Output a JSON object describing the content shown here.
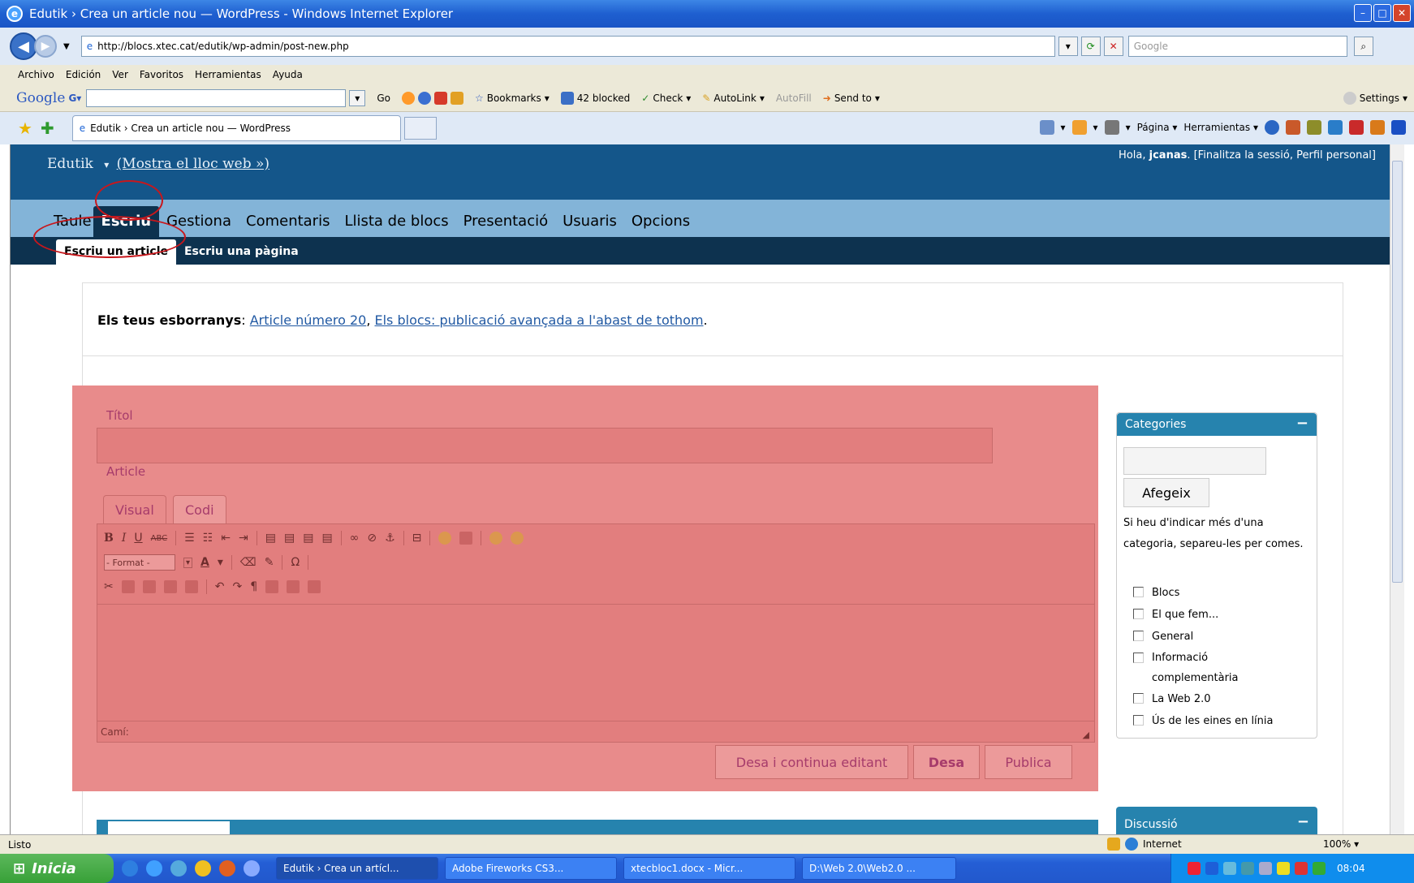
{
  "window": {
    "title": "Edutik › Crea un article nou — WordPress - Windows Internet Explorer",
    "url": "http://blocs.xtec.cat/edutik/wp-admin/post-new.php",
    "search_placeholder": "Google"
  },
  "menu": [
    "Archivo",
    "Edición",
    "Ver",
    "Favoritos",
    "Herramientas",
    "Ayuda"
  ],
  "googlebar": {
    "logo": "Google",
    "go": "Go",
    "bookmarks": "Bookmarks",
    "blocked": "42 blocked",
    "check": "Check",
    "autolink": "AutoLink",
    "autofill": "AutoFill",
    "sendto": "Send to",
    "settings": "Settings"
  },
  "tab": {
    "label": "Edutik › Crea un article nou — WordPress"
  },
  "commandbar": {
    "page": "Página",
    "tools": "Herramientas"
  },
  "wp": {
    "blog_name": "Edutik",
    "visit_site": "(Mostra el lloc web »)",
    "greeting": "Hola,",
    "username": "jcanas",
    "user_links": ". [Finalitza la sessió, Perfil personal]",
    "menu": [
      "Tauler",
      "Escriu",
      "Gestiona",
      "Comentaris",
      "Llista de blocs",
      "Presentació",
      "Usuaris",
      "Opcions"
    ],
    "menu_display": [
      "Taule",
      "Escriu",
      "Gestiona",
      "Comentaris",
      "Llista de blocs",
      "Presentació",
      "Usuaris",
      "Opcions"
    ],
    "submenu": [
      "Escriu un article",
      "Escriu una pàgina"
    ],
    "drafts_label": "Els teus esborranys",
    "drafts": [
      "Article número 20",
      "Els blocs: publicació avançada a l'abast de tothom"
    ],
    "title_label": "Títol",
    "article_label": "Article",
    "editor_tabs": [
      "Visual",
      "Codi"
    ],
    "format_select": "- Format -",
    "path_label": "Camí:",
    "buttons": {
      "save_continue": "Desa i continua editant",
      "save": "Desa",
      "publish": "Publica"
    },
    "categories": {
      "title": "Categories",
      "add_button": "Afegeix",
      "help": "Si heu d'indicar més d'una categoria, separeu-les per comes.",
      "items": [
        "Blocs",
        "El que fem...",
        "General",
        "Informació complementària",
        "La Web 2.0",
        "Ús de les eines en línia"
      ]
    },
    "discussion_title": "Discussió"
  },
  "statusbar": {
    "status": "Listo",
    "zone": "Internet",
    "zoom": "100%"
  },
  "taskbar": {
    "start": "Inicia",
    "tasks": [
      "Edutik › Crea un artícl...",
      "Adobe Fireworks CS3...",
      "xtecbloc1.docx - Micr...",
      "D:\\Web 2.0\\Web2.0 ..."
    ],
    "clock": "08:04"
  },
  "colors": {
    "wp_header": "#14568a",
    "wp_menu": "#83b4d8",
    "wp_submenu": "#0d324f",
    "highlight_overlay": "#e88b8b",
    "annotation_ring": "#c8171c",
    "box_header": "#2683ae"
  }
}
